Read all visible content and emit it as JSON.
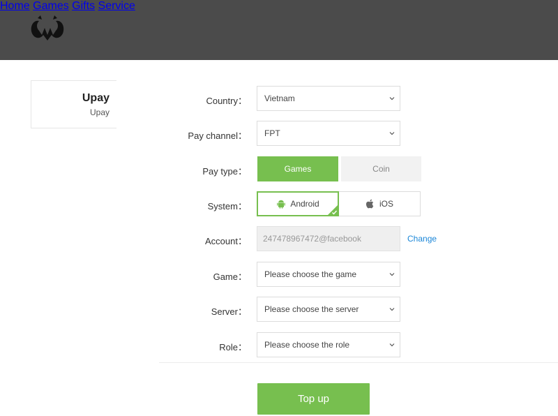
{
  "header": {
    "nav": [
      {
        "label": "Home"
      },
      {
        "label": "Games"
      },
      {
        "label": "Gifts"
      },
      {
        "label": "Service"
      }
    ]
  },
  "card": {
    "name": "Upay",
    "sub": "Upay"
  },
  "form": {
    "country": {
      "label": "Country",
      "value": "Vietnam"
    },
    "pay_channel": {
      "label": "Pay channel",
      "value": "FPT"
    },
    "pay_type": {
      "label": "Pay type",
      "options": [
        "Games",
        "Coin"
      ],
      "selected": "Games"
    },
    "system": {
      "label": "System",
      "options": [
        "Android",
        "iOS"
      ],
      "selected": "Android"
    },
    "account": {
      "label": "Account",
      "value": "247478967472@facebook",
      "change_label": "Change"
    },
    "game": {
      "label": "Game",
      "placeholder": "Please choose the game"
    },
    "server": {
      "label": "Server",
      "placeholder": "Please choose the server"
    },
    "role": {
      "label": "Role",
      "placeholder": "Please choose the role"
    },
    "colon": "："
  },
  "submit_label": "Top up",
  "colors": {
    "header_bg": "#4b4b4b",
    "accent": "#77bf4f",
    "link": "#1a86d8"
  }
}
